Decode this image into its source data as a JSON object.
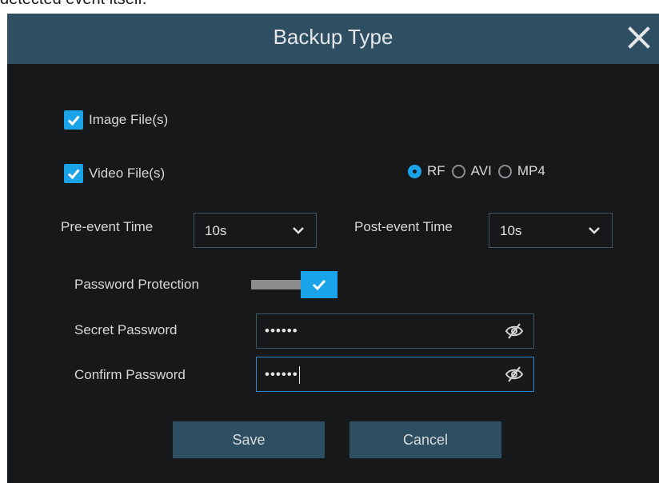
{
  "top_caption": "detected event itself.",
  "dialog": {
    "title": "Backup Type"
  },
  "options": {
    "image_files_label": "Image File(s)",
    "image_files_checked": true,
    "video_files_label": "Video File(s)",
    "video_files_checked": true
  },
  "format": {
    "options": [
      "RF",
      "AVI",
      "MP4"
    ],
    "selected": "RF"
  },
  "pre_event": {
    "label": "Pre-event Time",
    "value": "10s"
  },
  "post_event": {
    "label": "Post-event Time",
    "value": "10s"
  },
  "password_protection": {
    "label": "Password Protection",
    "enabled": true
  },
  "secret_password": {
    "label": "Secret Password",
    "value": "••••••"
  },
  "confirm_password": {
    "label": "Confirm Password",
    "value": "••••••"
  },
  "buttons": {
    "save": "Save",
    "cancel": "Cancel"
  },
  "colors": {
    "titlebar": "#2e4e61",
    "background": "#16181a",
    "accent": "#1aa3e8"
  },
  "icons": [
    "close-icon",
    "checkmark-icon",
    "chevron-down-icon",
    "eye-slash-icon"
  ]
}
